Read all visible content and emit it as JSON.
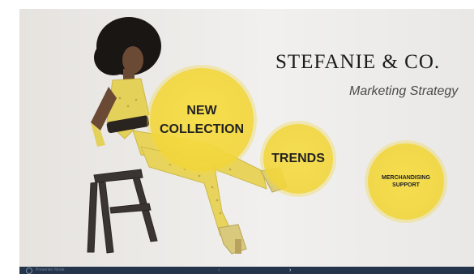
{
  "slide": {
    "brand": "STEFANIE & CO.",
    "subtitle": "Marketing Strategy",
    "bubbles": {
      "new_line1": "NEW",
      "new_line2": "COLLECTION",
      "trends": "TRENDS",
      "merch_line1": "MERCHANDISING",
      "merch_line2": "SUPPORT"
    }
  },
  "presenter_bar": {
    "label": "Presenter Mode",
    "prev_icon": "chevron-left-icon",
    "next_icon": "chevron-right-icon",
    "prev_glyph": "‹",
    "next_glyph": "›"
  },
  "colors": {
    "bubble_yellow": "#f2d63c",
    "bar": "#24344a",
    "frame_left": "#111111"
  }
}
